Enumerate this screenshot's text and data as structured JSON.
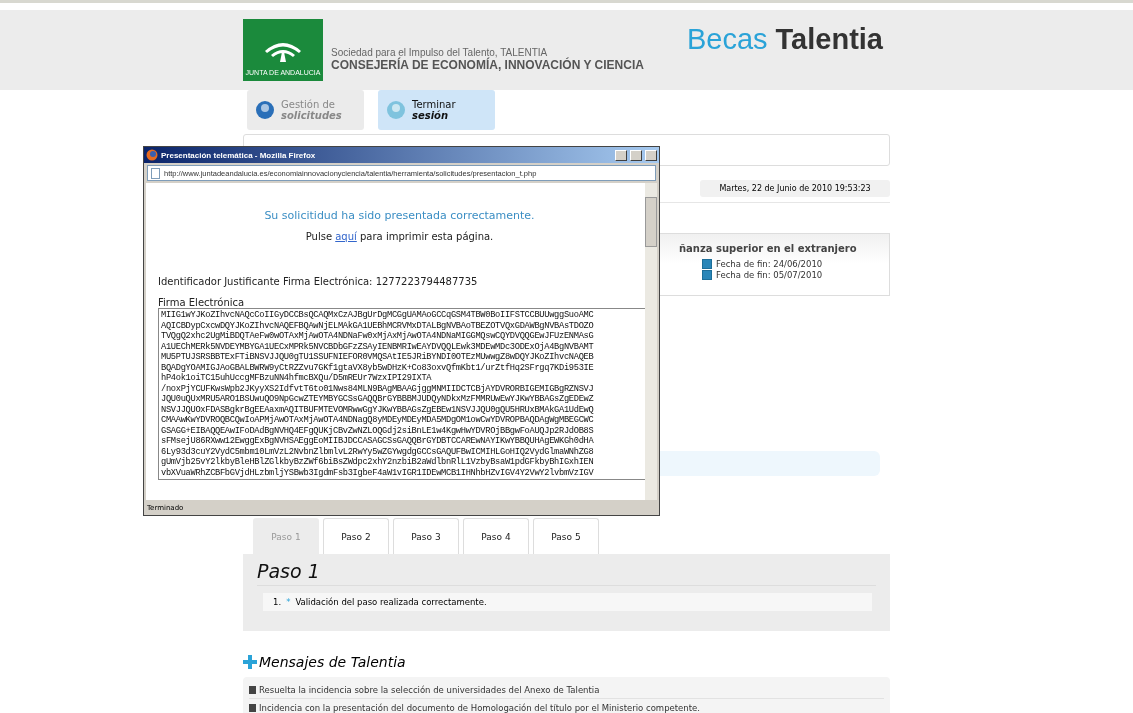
{
  "header": {
    "logo_caption": "JUNTA DE ANDALUCIA",
    "org_line": "Sociedad para el Impulso del Talento, TALENTIA",
    "ministry": "CONSEJERÍA DE ECONOMÍA, INNOVACIÓN Y CIENCIA",
    "brand_first": "Becas",
    "brand_second": "Talentia"
  },
  "nav": [
    {
      "line1": "Gestión de",
      "line2": "solicitudes",
      "selected": false
    },
    {
      "line1": "Terminar",
      "line2": "sesión",
      "selected": true
    }
  ],
  "date": "Martes, 22 de Junio de 2010 19:53:23",
  "convocatoria": {
    "title": "ñanza superior en el extranjero",
    "dates": [
      "Fecha de fin: 24/06/2010",
      "Fecha de fin: 05/07/2010"
    ]
  },
  "popup": {
    "title": "Presentación telemática - Mozilla Firefox",
    "url": "http://www.juntadeandalucia.es/economiainnovacionyciencia/talentia/herramienta/solicitudes/presentacion_t.php",
    "success": "Su solicitidud ha sido presentada correctamente.",
    "print_before": "Pulse ",
    "print_link": "aquí",
    "print_after": " para imprimir esta página.",
    "identifier": "Identificador Justificante Firma Electrónica: 1277223794487735",
    "signature_label": "Firma Electrónica",
    "status": "Terminado",
    "signature_lines": [
      "MIIG1wYJKoZIhvcNAQcCoIIGyDCCBsQCAQMxCzAJBgUrDgMCGgUAMAoGCCqGSM4TBW0BoIIFSTCCBUUwggSuoAMC",
      "AQICBDypCxcwDQYJKoZIhvcNAQEFBQAwNjELMAkGA1UEBhMCRVMxDTALBgNVBAoTBEZOTVQxGDAWBgNVBAsTDOZO",
      "TVQgQ2xhc2UgMiBDQTAeFw0wOTAxMjAwOTA4NDNaFw0xMjAxMjAwOTA4NDNaMIGGMQswCQYDVQQGEwJFUzENMAsG",
      "A1UEChMERk5NVDEYMBYGA1UECxMPRk5NVCBDbGFzZSAyIENBMRIwEAYDVQQLEwk3MDEwMDc3ODExOjA4BgNVBAMT",
      "MU5PTUJSRSBBTExFTiBNSVJJQU0gTU1SSUFNIEFOR0VMQSAtIE5JRiBYNDI0OTEzMUwwgZ8wDQYJKoZIhvcNAQEB",
      "BQADgYOAMIGJAoGBALBWRW9yCtRZZvu7GKf1gtaVX8yb5wDHzK+Co83oxvQfmKbt1/urZtfHq2SFrgq7KDi953IE",
      "hP4ok1oiTC15uhUccgMFBzuNN4hfmcBXQu/D5mREUr7WzxIPI29IXTA",
      "/noxPjYCUFKwsWpb2JKyyXS2IdfvtT6to01Nws84MLN9BAgMBAAGjggMNMIIDCTCBjAYDVRORBIGEMIGBgRZNSVJ",
      "JQU0uQUxMRU5ARO1BSUwuQO9NpGcwZTEYMBYGCSsGAQQBrGYBBBMJUDQyNDkxMzFMMRUwEwYJKwYBBAGsZgEDEwZ",
      "NSVJJQUOxFDASBgkrBgEEAaxmAQITBUFMTEVOMRwwGgYJKwYBBAGsZgEBEw1NSVJJQU0gQU5HRUxBMAkGA1UdEwQ",
      "CMAAwKwYDVROQBCQwIoAPMjAwOTAxMjAwOTA4NDNagQ8yMDEyMDEyMDA5MDgOM1owCwYDVROPBAQDAgWgMBEGCWC",
      "GSAGG+EIBAQQEAwIFoDAdBgNVHQ4EFgQUKjCBvZwNZLOQGdj2siBnLE1w4KgwHwYDVROjBBgwFoAUQJp2RJdOB8S",
      "sFMsejU86RXww12EwggExBgNVHSAEggEoMIIBJDCCASAGCSsGAQQBrGYDBTCCAREwNAYIKwYBBQUHAgEWKGh0dHA",
      "6Ly93d3cuY2VydC5mbm10LmVzL2NvbnZlbmlvL2RwYy5wZGYwgdgGCCsGAQUFBwICMIHLGoHIQ2VydGlmaWNhZG8",
      "gUmVjb25vY2lkbyBleHBlZGlkbyBzZWf6biBsZWdpc2xhY2nzbiB2aWdlbnRlL1VzbyBsaW1pdGFkbyBhIGxhIEN",
      "vbXVuaWRhZCBFbGVjdHLzbmljYSBwb3IgdmFsb3IgbeF4aW1vIGR1IDEwMCB1IHNhbHZvIGV4Y2VwY2lvbmVzIGV"
    ]
  },
  "steps": [
    {
      "label": "Paso 1",
      "selected": true
    },
    {
      "label": "Paso 2",
      "selected": false
    },
    {
      "label": "Paso 3",
      "selected": false
    },
    {
      "label": "Paso 4",
      "selected": false
    },
    {
      "label": "Paso 5",
      "selected": false
    }
  ],
  "step_panel": {
    "title": "Paso 1",
    "items": [
      {
        "number": "1.",
        "mark": "*",
        "text": "Validación del paso realizada correctamente."
      }
    ]
  },
  "messages": {
    "title": "Mensajes de Talentia",
    "items": [
      "Resuelta la incidencia sobre la selección de universidades del Anexo de Talentia",
      "Incidencia con la presentación del documento de Homologación del título por el Ministerio competente."
    ]
  }
}
